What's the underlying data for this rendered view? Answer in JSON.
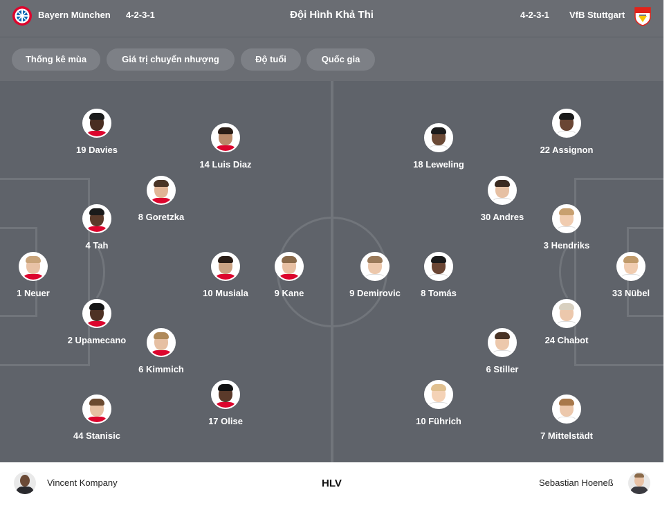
{
  "header": {
    "title": "Đội Hình Khả Thi",
    "home_team": "Bayern München",
    "home_formation": "4-2-3-1",
    "away_team": "VfB Stuttgart",
    "away_formation": "4-2-3-1",
    "home_crest_icon": "bayern-crest-icon",
    "away_crest_icon": "stuttgart-crest-icon"
  },
  "tabs": [
    {
      "label": "Thống kê mùa"
    },
    {
      "label": "Giá trị chuyển nhượng"
    },
    {
      "label": "Độ tuổi"
    },
    {
      "label": "Quốc gia"
    }
  ],
  "home_players": [
    {
      "name": "19 Davies"
    },
    {
      "name": "14 Luis Diaz"
    },
    {
      "name": "8 Goretzka"
    },
    {
      "name": "4 Tah"
    },
    {
      "name": "1 Neuer"
    },
    {
      "name": "10 Musiala"
    },
    {
      "name": "9 Kane"
    },
    {
      "name": "2 Upamecano"
    },
    {
      "name": "6 Kimmich"
    },
    {
      "name": "17 Olise"
    },
    {
      "name": "44 Stanisic"
    }
  ],
  "away_players": [
    {
      "name": "18 Leweling"
    },
    {
      "name": "22 Assignon"
    },
    {
      "name": "30 Andres"
    },
    {
      "name": "3 Hendriks"
    },
    {
      "name": "9 Demirovic"
    },
    {
      "name": "8 Tomás"
    },
    {
      "name": "33 Nübel"
    },
    {
      "name": "24 Chabot"
    },
    {
      "name": "6 Stiller"
    },
    {
      "name": "10 Führich"
    },
    {
      "name": "7 Mittelstädt"
    }
  ],
  "footer": {
    "home_coach": "Vincent Kompany",
    "away_coach": "Sebastian Hoeneß",
    "label": "HLV"
  },
  "colors": {
    "pitch": "#5f636a",
    "header": "#6a6d73",
    "tab": "#7d8086",
    "lines": "#71757b"
  }
}
